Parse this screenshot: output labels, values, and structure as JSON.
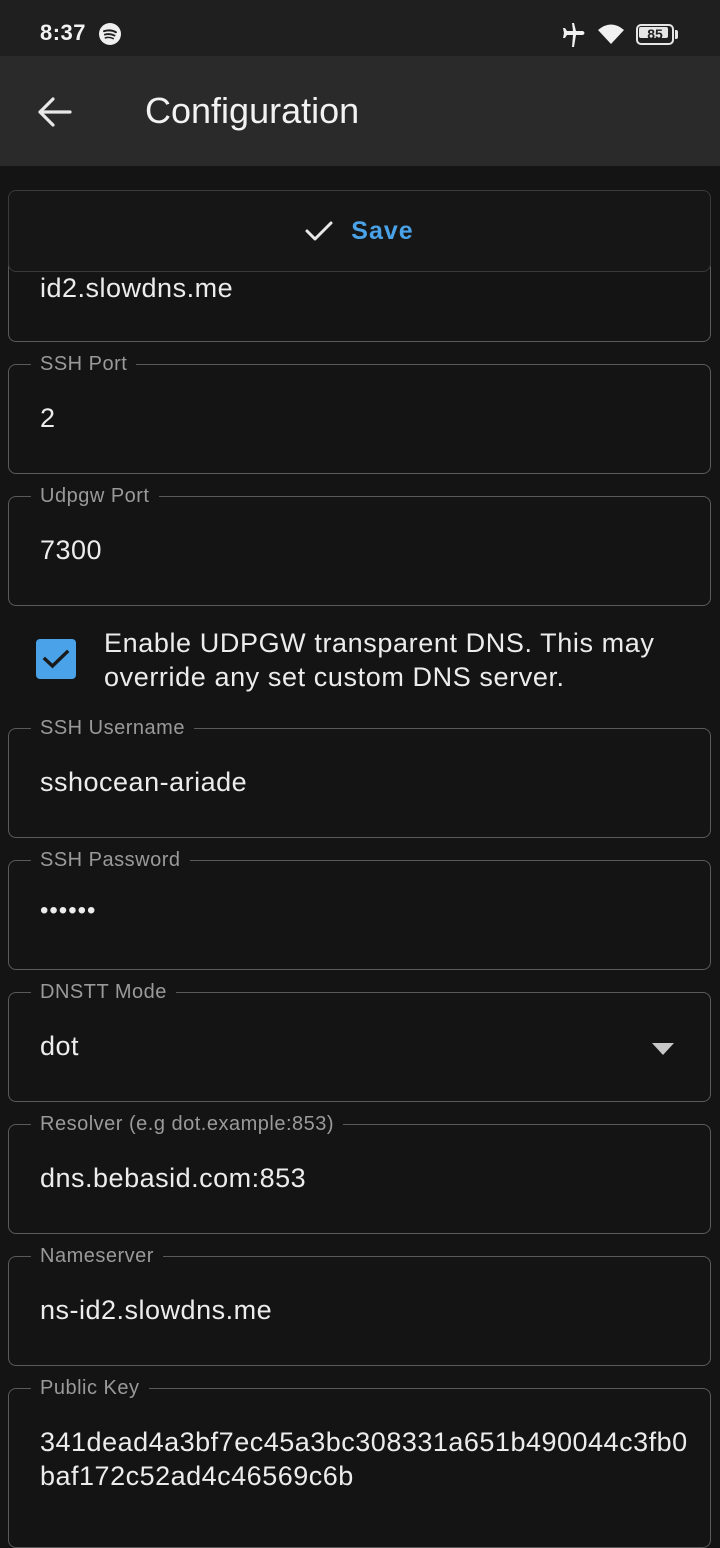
{
  "status_bar": {
    "time": "8:37",
    "battery": "85",
    "icons": [
      "spotify-icon",
      "airplane-mode-icon",
      "wifi-icon",
      "battery-icon"
    ]
  },
  "app_bar": {
    "title": "Configuration",
    "back_icon": "arrow-left-icon"
  },
  "save": {
    "label": "Save",
    "icon": "check-icon",
    "accent_color": "#4aa3e8"
  },
  "partial_field": {
    "value": "id2.slowdns.me"
  },
  "fields": {
    "ssh_port": {
      "label": "SSH Port",
      "value": "2"
    },
    "udpgw_port": {
      "label": "Udpgw Port",
      "value": "7300"
    },
    "ssh_username": {
      "label": "SSH Username",
      "value": "sshocean-ariade"
    },
    "ssh_password": {
      "label": "SSH Password",
      "value": "••••••"
    },
    "dnstt_mode": {
      "label": "DNSTT Mode",
      "value": "dot"
    },
    "resolver": {
      "label": "Resolver (e.g dot.example:853)",
      "value": "dns.bebasid.com:853"
    },
    "nameserver": {
      "label": "Nameserver",
      "value": "ns-id2.slowdns.me"
    },
    "public_key": {
      "label": "Public Key",
      "value": "341dead4a3bf7ec45a3bc308331a651b490044c3fb0baf172c52ad4c46569c6b"
    }
  },
  "udpgw_dns": {
    "checked": true,
    "label": "Enable UDPGW transparent DNS. This may override any set custom DNS server."
  }
}
